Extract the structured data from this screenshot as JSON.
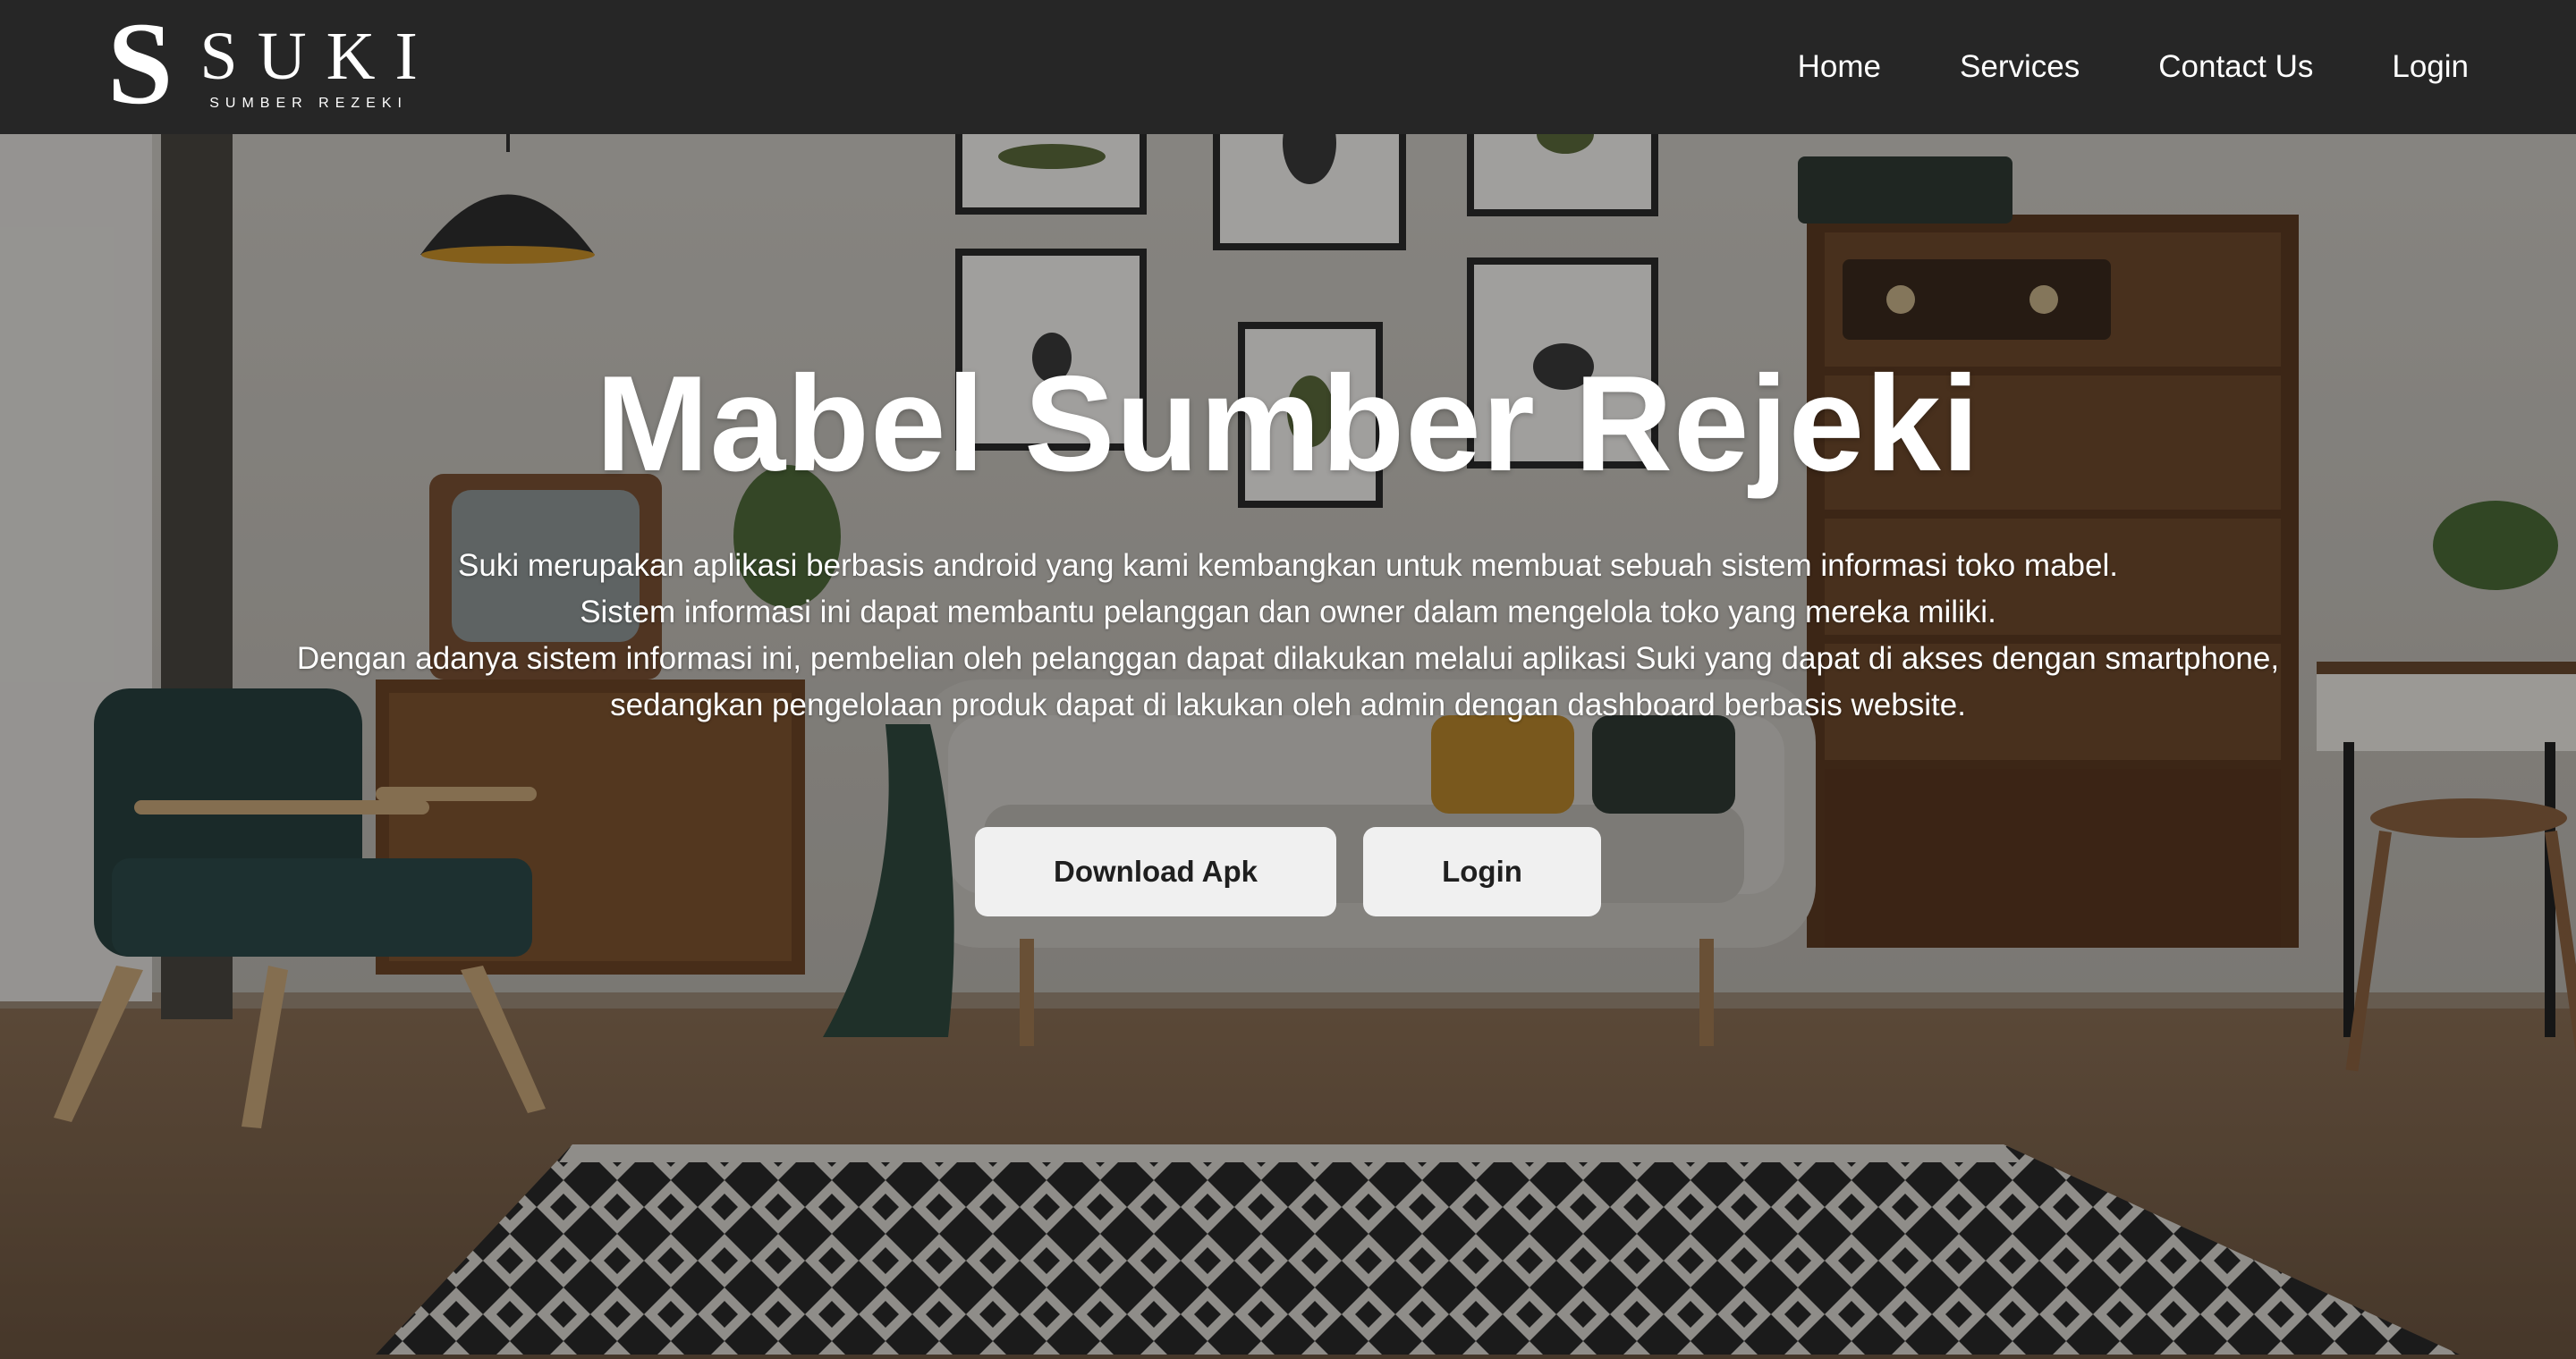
{
  "brand": {
    "mark": "S",
    "name": "SUKI",
    "tagline": "SUMBER REZEKI"
  },
  "nav": {
    "items": [
      {
        "label": "Home"
      },
      {
        "label": "Services"
      },
      {
        "label": "Contact Us"
      },
      {
        "label": "Login"
      }
    ]
  },
  "hero": {
    "title": "Mabel Sumber Rejeki",
    "description": [
      "Suki merupakan aplikasi berbasis android yang kami kembangkan untuk membuat sebuah sistem informasi toko mabel.",
      "Sistem informasi ini dapat membantu pelanggan dan owner dalam mengelola toko yang mereka miliki.",
      "Dengan adanya sistem informasi ini, pembelian oleh pelanggan dapat dilakukan melalui aplikasi Suki yang dapat di akses dengan smartphone,",
      "sedangkan pengelolaan produk dapat di lakukan oleh admin dengan dashboard berbasis website."
    ],
    "buttons": {
      "download": "Download Apk",
      "login": "Login"
    }
  },
  "colors": {
    "navbar": "#262626",
    "button_bg": "#f0f0f0",
    "button_text": "#1f1f1f",
    "text": "#ffffff"
  }
}
